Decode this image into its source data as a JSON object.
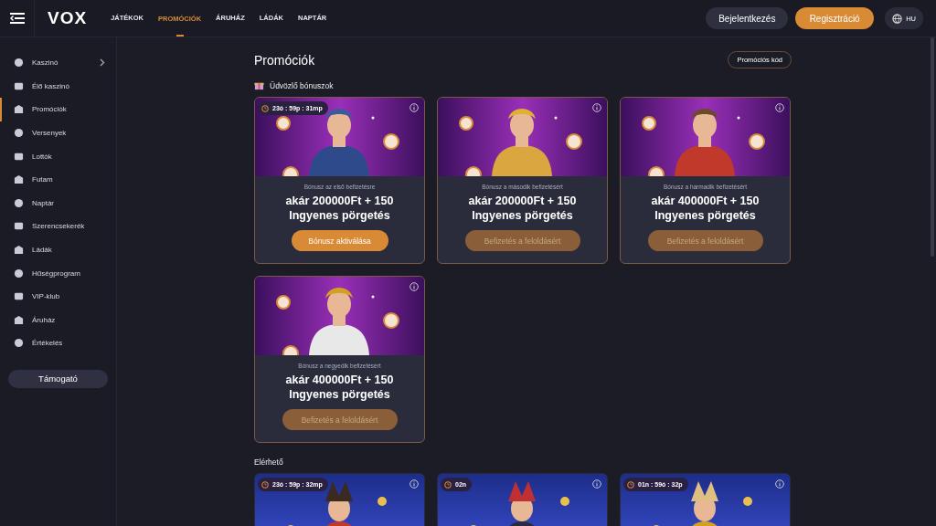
{
  "topbar": {
    "logo": "VOX",
    "nav": [
      {
        "label": "JÁTÉKOK",
        "selected": false
      },
      {
        "label": "PROMÓCIÓK",
        "selected": true
      },
      {
        "label": "ÁRUHÁZ",
        "selected": false
      },
      {
        "label": "LÁDÁK",
        "selected": false
      },
      {
        "label": "NAPTÁR",
        "selected": false
      }
    ],
    "login": "Bejelentkezés",
    "register": "Regisztráció",
    "language": "HU"
  },
  "sidebar": {
    "items": [
      {
        "label": "Kaszinó",
        "selected": false,
        "expandable": true
      },
      {
        "label": "Élő kaszinó",
        "selected": false,
        "expandable": false
      },
      {
        "label": "Promóciók",
        "selected": true,
        "expandable": false
      },
      {
        "label": "Versenyek",
        "selected": false,
        "expandable": false
      },
      {
        "label": "Lottók",
        "selected": false,
        "expandable": false
      },
      {
        "label": "Futam",
        "selected": false,
        "expandable": false
      },
      {
        "label": "Naptár",
        "selected": false,
        "expandable": false
      },
      {
        "label": "Szerencsekerék",
        "selected": false,
        "expandable": false
      },
      {
        "label": "Ládák",
        "selected": false,
        "expandable": false
      },
      {
        "label": "Hűségprogram",
        "selected": false,
        "expandable": false
      },
      {
        "label": "VIP-klub",
        "selected": false,
        "expandable": false
      },
      {
        "label": "Áruház",
        "selected": false,
        "expandable": false
      },
      {
        "label": "Értékelés",
        "selected": false,
        "expandable": false
      }
    ],
    "support": "Támogató"
  },
  "page": {
    "title": "Promóciók",
    "promo_code": "Promóciós kód"
  },
  "welcome": {
    "heading": "Üdvözlő bónuszok",
    "cards": [
      {
        "kind": "purple",
        "timer": "23ó : 59p : 31mp",
        "subtitle": "Bónusz az első befizetésre",
        "title": "akár 200000Ft + 150 Ingyenes pörgetés",
        "button": "Bónusz aktiválása",
        "disabled": false
      },
      {
        "kind": "purple",
        "subtitle": "Bónusz a második befizetésért",
        "title": "akár 200000Ft + 150 Ingyenes pörgetés",
        "button": "Befizetés a feloldásért",
        "disabled": true
      },
      {
        "kind": "purple",
        "subtitle": "Bónusz a harmadik befizetésért",
        "title": "akár 400000Ft + 150 Ingyenes pörgetés",
        "button": "Befizetés a feloldásért",
        "disabled": true
      },
      {
        "kind": "purple",
        "subtitle": "Bónusz a negyedik befizetésért",
        "title": "akár 400000Ft + 150 Ingyenes pörgetés",
        "button": "Befizetés a feloldásért",
        "disabled": true
      }
    ]
  },
  "available": {
    "heading": "Elérhető",
    "cards": [
      {
        "kind": "blue",
        "timer": "23ó : 59p : 32mp"
      },
      {
        "kind": "blue",
        "timer": "02n"
      },
      {
        "kind": "blue",
        "timer": "01n : 59ó : 32p"
      }
    ]
  }
}
